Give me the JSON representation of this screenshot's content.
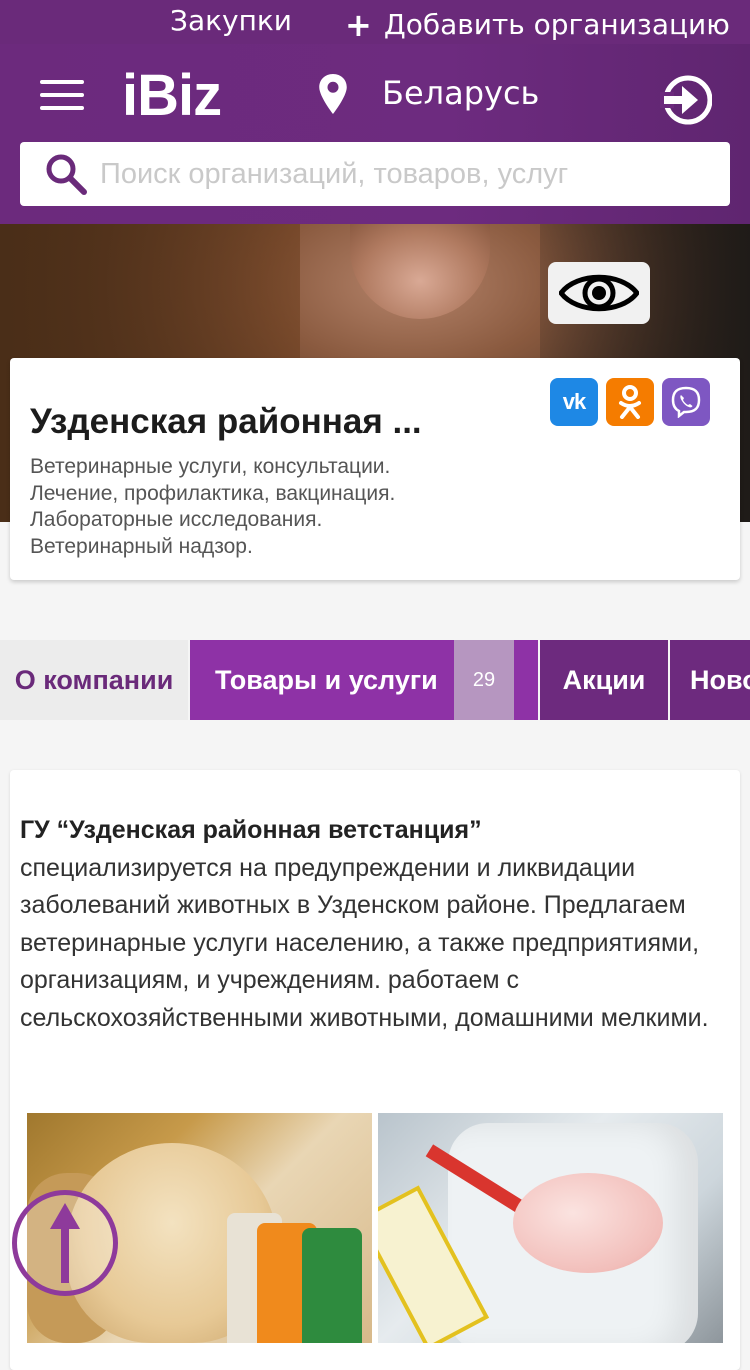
{
  "topbar": {
    "procurement_label": "Закупки",
    "add_org_label": "Добавить организацию"
  },
  "header": {
    "logo": "iBiz",
    "location": "Беларусь",
    "search_placeholder": "Поиск организаций, товаров, услуг"
  },
  "org": {
    "title": "Узденская районная ...",
    "description_lines": [
      "Ветеринарные услуги, консультации.",
      "Лечение, профилактика, вакцинация.",
      "Лабораторные исследования.",
      "Ветеринарный надзор."
    ],
    "social": {
      "vk": "VK",
      "ok": "OK",
      "viber": "Viber"
    }
  },
  "tabs": {
    "about": "О компании",
    "goods": "Товары и услуги",
    "goods_count": "29",
    "promo": "Акции",
    "news": "Новости"
  },
  "about": {
    "name": "ГУ “Узденская районная ветстанция”",
    "body": "специализируется на предупреждении и ликвидации заболеваний животных в Узденском районе. Предлагаем ветеринарные услуги населению, а также предприятиями, организациям, и учреждениям. работаем с сельскохозяйственными животными, домашними мелкими."
  },
  "colors": {
    "brand_purple": "#6a2a7a",
    "tab_active": "#8e32a6",
    "vk": "#1e88e5",
    "ok": "#f57c00",
    "viber": "#7e57c2"
  }
}
